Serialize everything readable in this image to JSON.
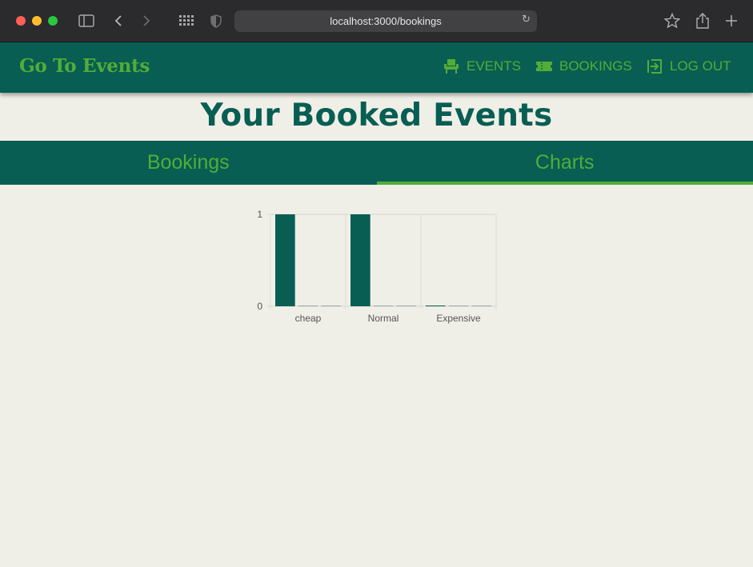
{
  "browser": {
    "url": "localhost:3000/bookings"
  },
  "header": {
    "brand": "Go To Events",
    "nav": [
      {
        "label": "EVENTS",
        "icon": "chair-icon"
      },
      {
        "label": "BOOKINGS",
        "icon": "ticket-icon"
      },
      {
        "label": "LOG OUT",
        "icon": "logout-icon"
      }
    ]
  },
  "page": {
    "title": "Your Booked Events"
  },
  "tabs": [
    {
      "label": "Bookings",
      "active": false
    },
    {
      "label": "Charts",
      "active": true
    }
  ],
  "colors": {
    "primary": "#085e52",
    "accent": "#52ad37",
    "background": "#efefe8"
  },
  "chart_data": {
    "type": "bar",
    "categories": [
      "cheap",
      "Normal",
      "Expensive"
    ],
    "series": [
      {
        "values": [
          1,
          1,
          0
        ],
        "color": "#085e52"
      },
      {
        "values": [
          0,
          0,
          0
        ],
        "color": "#9aa8a5"
      },
      {
        "values": [
          0,
          0,
          0
        ],
        "color": "#9aa8a5"
      }
    ],
    "ylim": [
      0,
      1
    ],
    "yticks": [
      "0",
      "1"
    ],
    "grid": true
  }
}
